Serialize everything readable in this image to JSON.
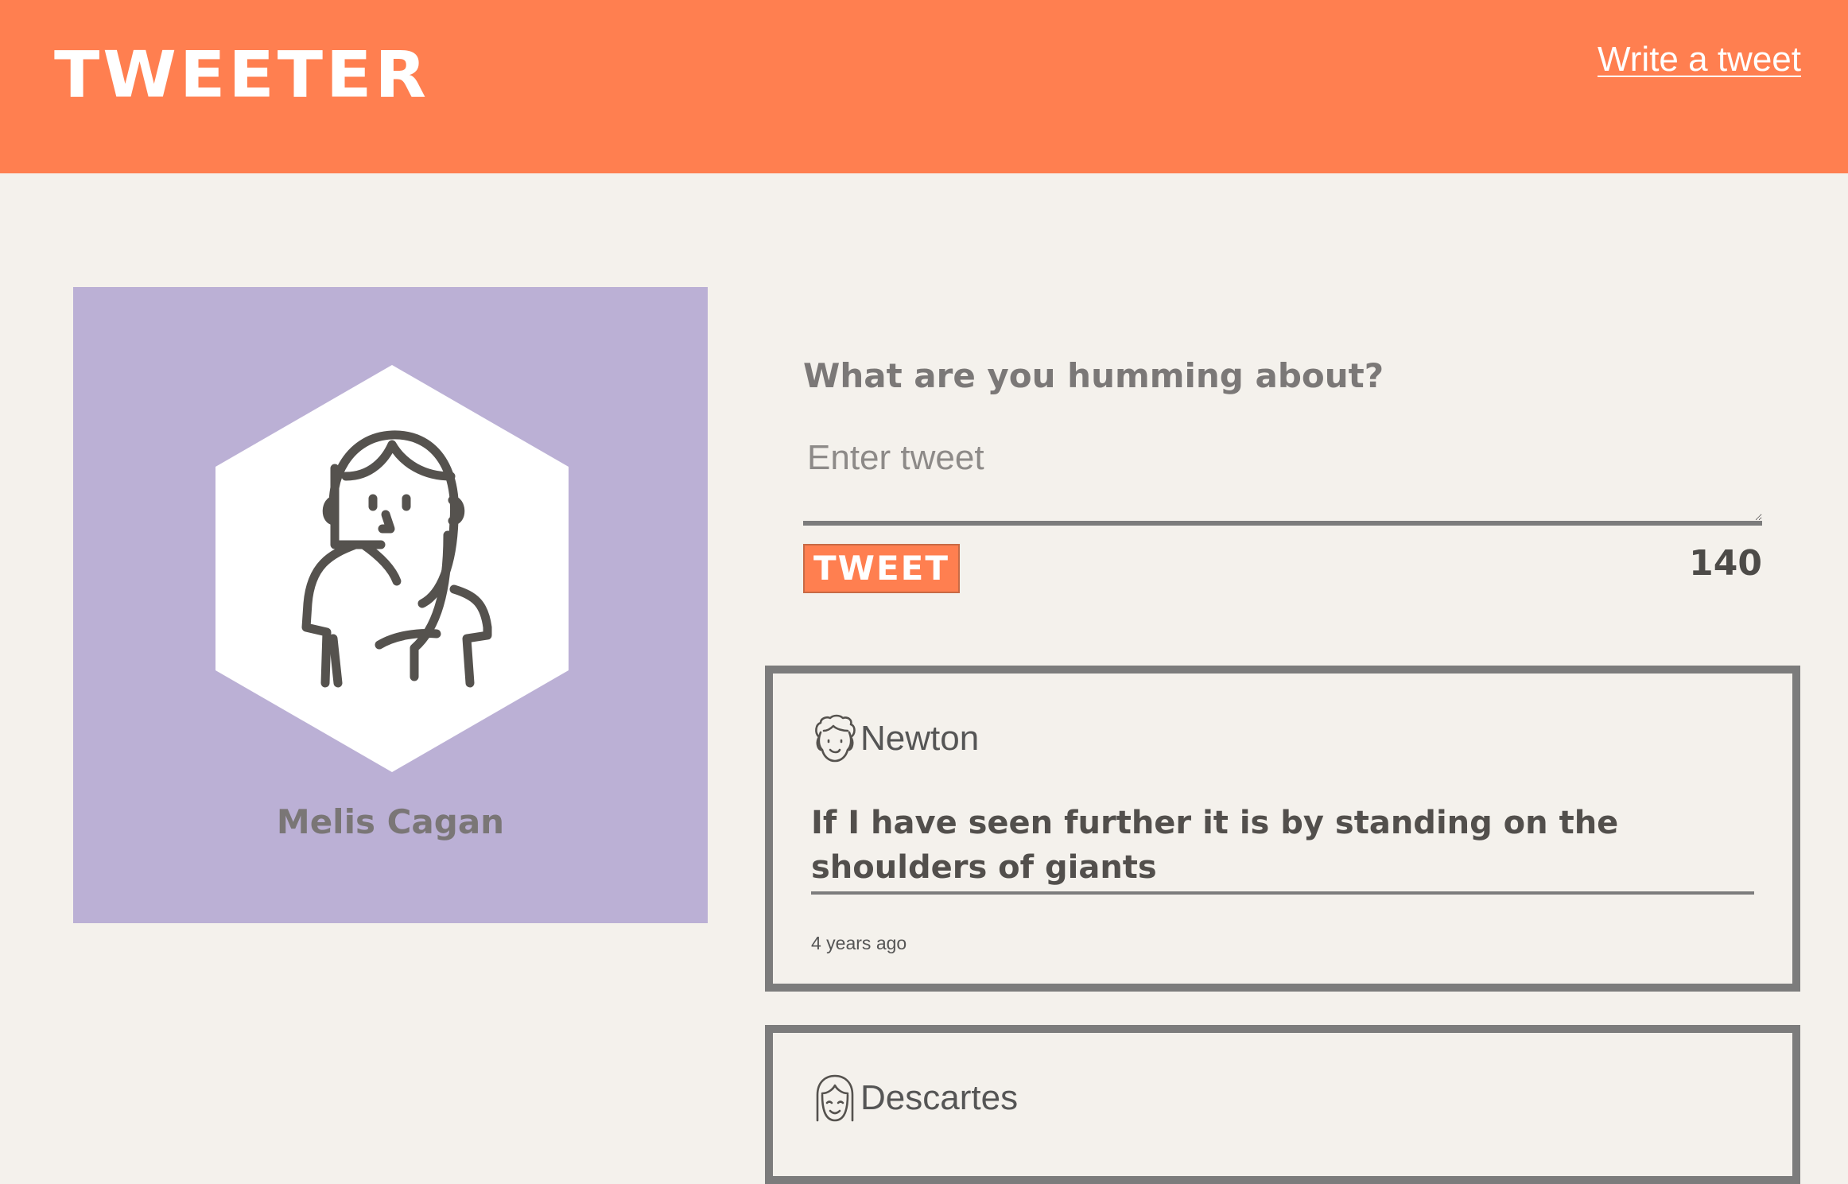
{
  "header": {
    "logo": "TWEETER",
    "write_link": "Write a tweet"
  },
  "profile": {
    "name": "Melis Cagan",
    "card_color": "#bbb0d5"
  },
  "composer": {
    "label": "What are you humming about?",
    "placeholder": "Enter tweet",
    "button_label": "TWEET",
    "char_count": "140"
  },
  "tweets": [
    {
      "author": "Newton",
      "avatar_icon": "newton-avatar-icon",
      "text": "If I have seen further it is by standing on the shoulders of giants",
      "time": "4 years ago"
    },
    {
      "author": "Descartes",
      "avatar_icon": "descartes-avatar-icon"
    }
  ],
  "colors": {
    "brand": "#ff7f50",
    "background": "#f4f1ec",
    "border": "#7c7c7c"
  }
}
